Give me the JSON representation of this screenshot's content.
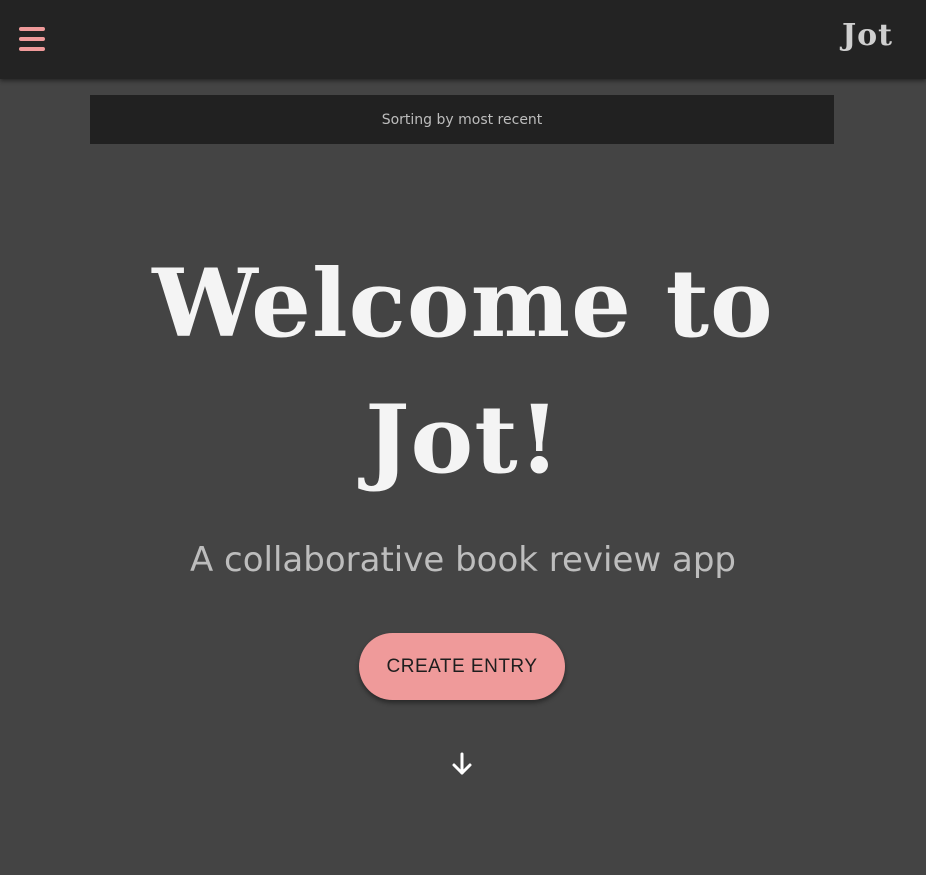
{
  "header": {
    "menu_icon": "hamburger-menu-icon",
    "brand": "Jot",
    "brand_color": "#cfcfcf",
    "accent_color": "#ef9a9a"
  },
  "sort_bar": {
    "label": "Sorting by most recent"
  },
  "hero": {
    "title": "Welcome to Jot!",
    "tagline": "A collaborative book review app",
    "cta_label": "CREATE ENTRY",
    "scroll_icon": "arrow-down-icon"
  },
  "colors": {
    "background": "#444444",
    "topbar": "#232323",
    "sort_bar": "#212121",
    "button": "#ef9a9a"
  }
}
